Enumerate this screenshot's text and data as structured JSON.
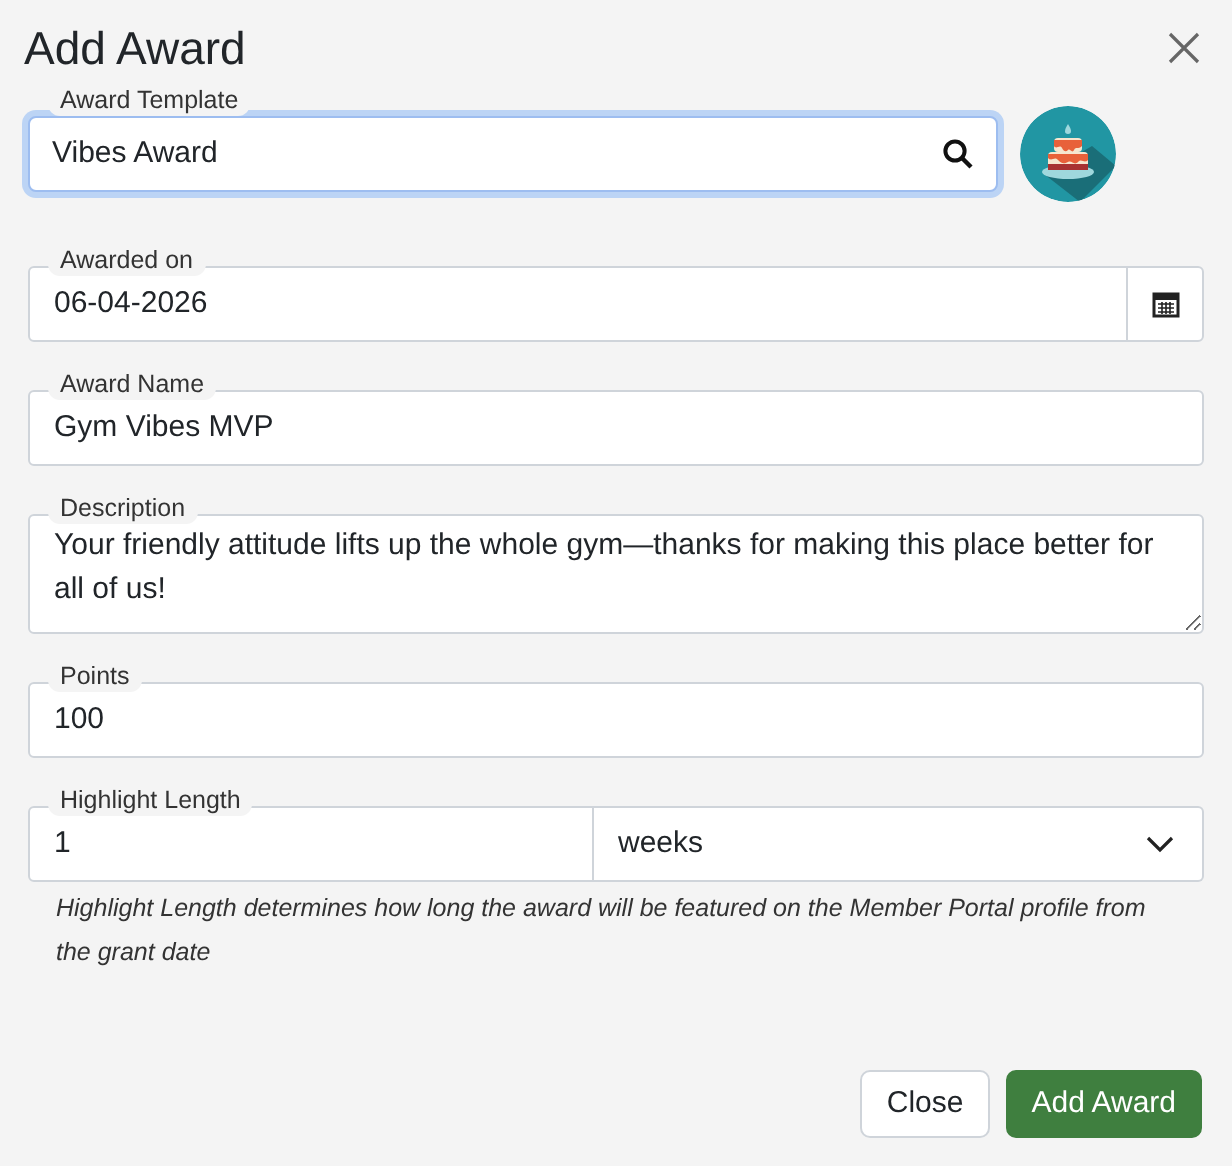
{
  "dialog": {
    "title": "Add Award"
  },
  "fields": [
    {
      "kind": "search",
      "label": "Award Template",
      "value": "Vibes Award",
      "focused": true
    },
    {
      "kind": "date",
      "label": "Awarded on",
      "value": "06-04-2026",
      "focused": false
    },
    {
      "kind": "text",
      "label": "Award Name",
      "value": "Gym Vibes MVP",
      "focused": false
    },
    {
      "kind": "textarea",
      "label": "Description",
      "value": "Your friendly attitude lifts up the whole gym—thanks for making this place better for all of us!",
      "focused": false
    },
    {
      "kind": "text",
      "label": "Points",
      "value": "100",
      "focused": false
    },
    {
      "kind": "duration",
      "label": "Highlight Length",
      "value": "1",
      "unit": "weeks",
      "help": "Highlight Length determines how long the award will be featured on the Member Portal profile from the grant date",
      "focused": false
    }
  ],
  "buttons": [
    {
      "label": "Close",
      "kind": "secondary"
    },
    {
      "label": "Add Award",
      "kind": "primary"
    }
  ]
}
